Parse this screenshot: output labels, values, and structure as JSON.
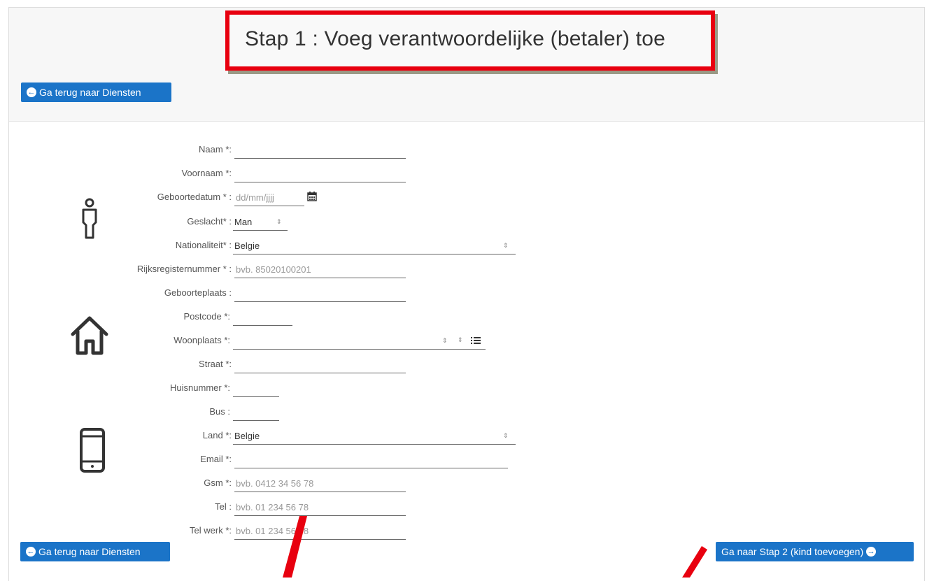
{
  "header": {
    "title": "Stap 1 : Voeg verantwoordelijke (betaler) toe",
    "back_button": "Ga terug naar Diensten"
  },
  "form": {
    "naam_label": "Naam *:",
    "voornaam_label": "Voornaam *:",
    "geboortedatum_label": "Geboortedatum * :",
    "geboortedatum_placeholder": "dd/mm/jjjj",
    "geslacht_label": "Geslacht* :",
    "geslacht_value": "Man",
    "nationaliteit_label": "Nationaliteit* :",
    "nationaliteit_value": "Belgie",
    "rijksregister_label": "Rijksregisternummer * :",
    "rijksregister_placeholder": "bvb. 85020100201",
    "geboorteplaats_label": "Geboorteplaats :",
    "postcode_label": "Postcode *:",
    "woonplaats_label": "Woonplaats *:",
    "straat_label": "Straat *:",
    "huisnummer_label": "Huisnummer *:",
    "bus_label": "Bus :",
    "land_label": "Land *:",
    "land_value": "Belgie",
    "email_label": "Email *:",
    "gsm_label": "Gsm *:",
    "gsm_placeholder": "bvb. 0412 34 56 78",
    "tel_label": "Tel :",
    "tel_placeholder": "bvb. 01 234 56 78",
    "telwerk_label": "Tel werk *:",
    "telwerk_placeholder": "bvb. 01 234 56 78"
  },
  "footer": {
    "back_button": "Ga terug naar Diensten",
    "next_button": "Ga naar Stap 2 (kind toevoegen)"
  },
  "icons": {
    "person": "person-icon",
    "home": "home-icon",
    "phone": "mobile-phone-icon",
    "calendar": "calendar-icon",
    "list": "list-icon",
    "back": "arrow-circle-left-icon",
    "next": "arrow-circle-right-icon"
  },
  "colors": {
    "accent": "#1b74c8",
    "highlight": "#e8000f"
  }
}
